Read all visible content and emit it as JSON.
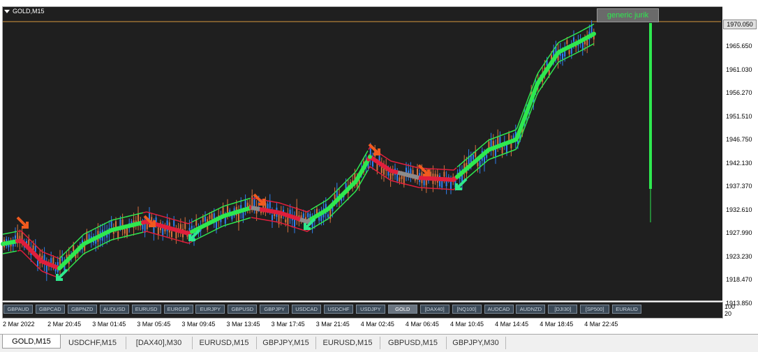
{
  "chart": {
    "symbol": "GOLD,M15",
    "indicator_name": "generic jurik",
    "current_price": "1970.050",
    "price_levels": [
      "1965.650",
      "1961.030",
      "1956.270",
      "1951.510",
      "1946.750",
      "1942.130",
      "1937.370",
      "1932.610",
      "1927.990",
      "1923.230",
      "1918.470",
      "1913.850"
    ],
    "sub_levels": [
      "100",
      "20"
    ],
    "time_labels": [
      "2 Mar 2022",
      "2 Mar 20:45",
      "3 Mar 01:45",
      "3 Mar 05:45",
      "3 Mar 09:45",
      "3 Mar 13:45",
      "3 Mar 17:45",
      "3 Mar 21:45",
      "4 Mar 02:45",
      "4 Mar 06:45",
      "4 Mar 10:45",
      "4 Mar 14:45",
      "4 Mar 18:45",
      "4 Mar 22:45"
    ]
  },
  "symbol_buttons": [
    "GBPAUD",
    "GBPCAD",
    "GBPNZD",
    "AUDUSD",
    "EURUSD",
    "EURGBP",
    "EURJPY",
    "GBPUSD",
    "GBPJPY",
    "USDCAD",
    "USDCHF",
    "USDJPY",
    "GOLD",
    "[DAX40]",
    "[NQ100]",
    "AUDCAD",
    "AUDNZD",
    "[DJI30]",
    "[SP500]",
    "EURAUD"
  ],
  "active_symbol": "GOLD",
  "tabs": [
    "GOLD,M15",
    "USDCHF,M15",
    "[DAX40],M30",
    "EURUSD,M15",
    "GBPJPY,M15",
    "EURUSD,M15",
    "GBPUSD,M15",
    "GBPJPY,M30"
  ],
  "active_tab": 0,
  "colors": {
    "background": "#1f1f1f",
    "up_candle": "#2e7ff0",
    "down_candle": "#d8713c",
    "band_green": "#2ee84f",
    "band_red": "#e01e3c",
    "arrow_up": "#2ee88c",
    "arrow_down": "#f05a1e",
    "neutral_dots": "#8c8c8c",
    "price_line": "#d89a3c"
  }
}
